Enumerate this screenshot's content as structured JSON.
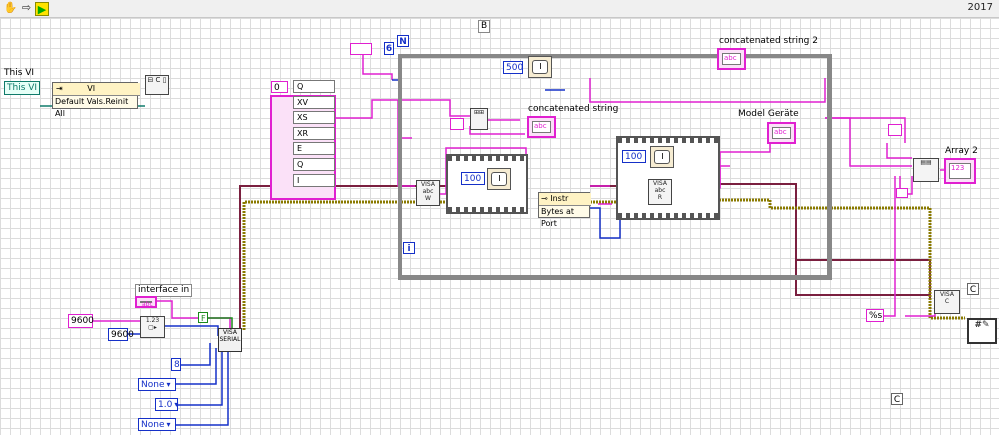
{
  "toolbar": {
    "version": "2017",
    "icons": [
      "hand-icon",
      "arrow-icon",
      "run-icon"
    ]
  },
  "labels": {
    "this_vi": "This VI",
    "this_vi_ref": "This VI",
    "invoke_class": "VI",
    "invoke_method": "Default Vals.Reinit All",
    "frame_label_b": "B",
    "concat2": "concatenated string 2",
    "concat": "concatenated string",
    "model": "Model Geräte",
    "array2": "Array 2",
    "interface_in": "interface in",
    "instr_class": "Instr",
    "bytes_at_port": "Bytes at Port",
    "case_c1": "C",
    "case_c2": "C",
    "loop_n": "N",
    "loop_i": "i",
    "loop_stop": "C"
  },
  "constants": {
    "loop_count": "6",
    "wait_500": "500",
    "wait_100a": "100",
    "wait_100b": "100",
    "baud1": "9600",
    "baud2": "9600",
    "data_bits": "8",
    "parity": "None",
    "stop_bits": "1.0",
    "flow": "None",
    "false_const": "F",
    "format": "%s",
    "array_index": "0"
  },
  "array_items": [
    "Q",
    "XV",
    "XS",
    "XR",
    "E",
    "Q",
    "I"
  ],
  "colors": {
    "string_wire": "#e020d0",
    "numeric_wire": "#1530c8",
    "error_wire": "#b8a000",
    "refnum_wire": "#7a1f3f",
    "boolean_wire": "#1b8a1b"
  }
}
